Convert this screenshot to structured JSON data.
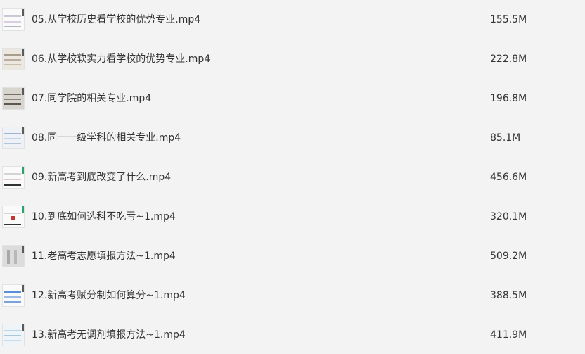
{
  "files": [
    {
      "name": "05.从学校历史看学校的优势专业.mp4",
      "size": "155.5M",
      "thumb_icon": "video-thumbnail-icon"
    },
    {
      "name": "06.从学校软实力看学校的优势专业.mp4",
      "size": "222.8M",
      "thumb_icon": "video-thumbnail-icon"
    },
    {
      "name": "07.同学院的相关专业.mp4",
      "size": "196.8M",
      "thumb_icon": "video-thumbnail-icon"
    },
    {
      "name": "08.同一一级学科的相关专业.mp4",
      "size": "85.1M",
      "thumb_icon": "video-thumbnail-icon"
    },
    {
      "name": "09.新高考到底改变了什么.mp4",
      "size": "456.6M",
      "thumb_icon": "video-thumbnail-icon"
    },
    {
      "name": "10.到底如何选科不吃亏~1.mp4",
      "size": "320.1M",
      "thumb_icon": "video-thumbnail-icon"
    },
    {
      "name": "11.老高考志愿填报方法~1.mp4",
      "size": "509.2M",
      "thumb_icon": "video-thumbnail-icon"
    },
    {
      "name": "12.新高考赋分制如何算分~1.mp4",
      "size": "388.5M",
      "thumb_icon": "video-thumbnail-icon"
    },
    {
      "name": "13.新高考无调剂填报方法~1.mp4",
      "size": "411.9M",
      "thumb_icon": "video-thumbnail-icon"
    }
  ],
  "colors": {
    "background": "#f3f3f3",
    "text": "#333333"
  }
}
